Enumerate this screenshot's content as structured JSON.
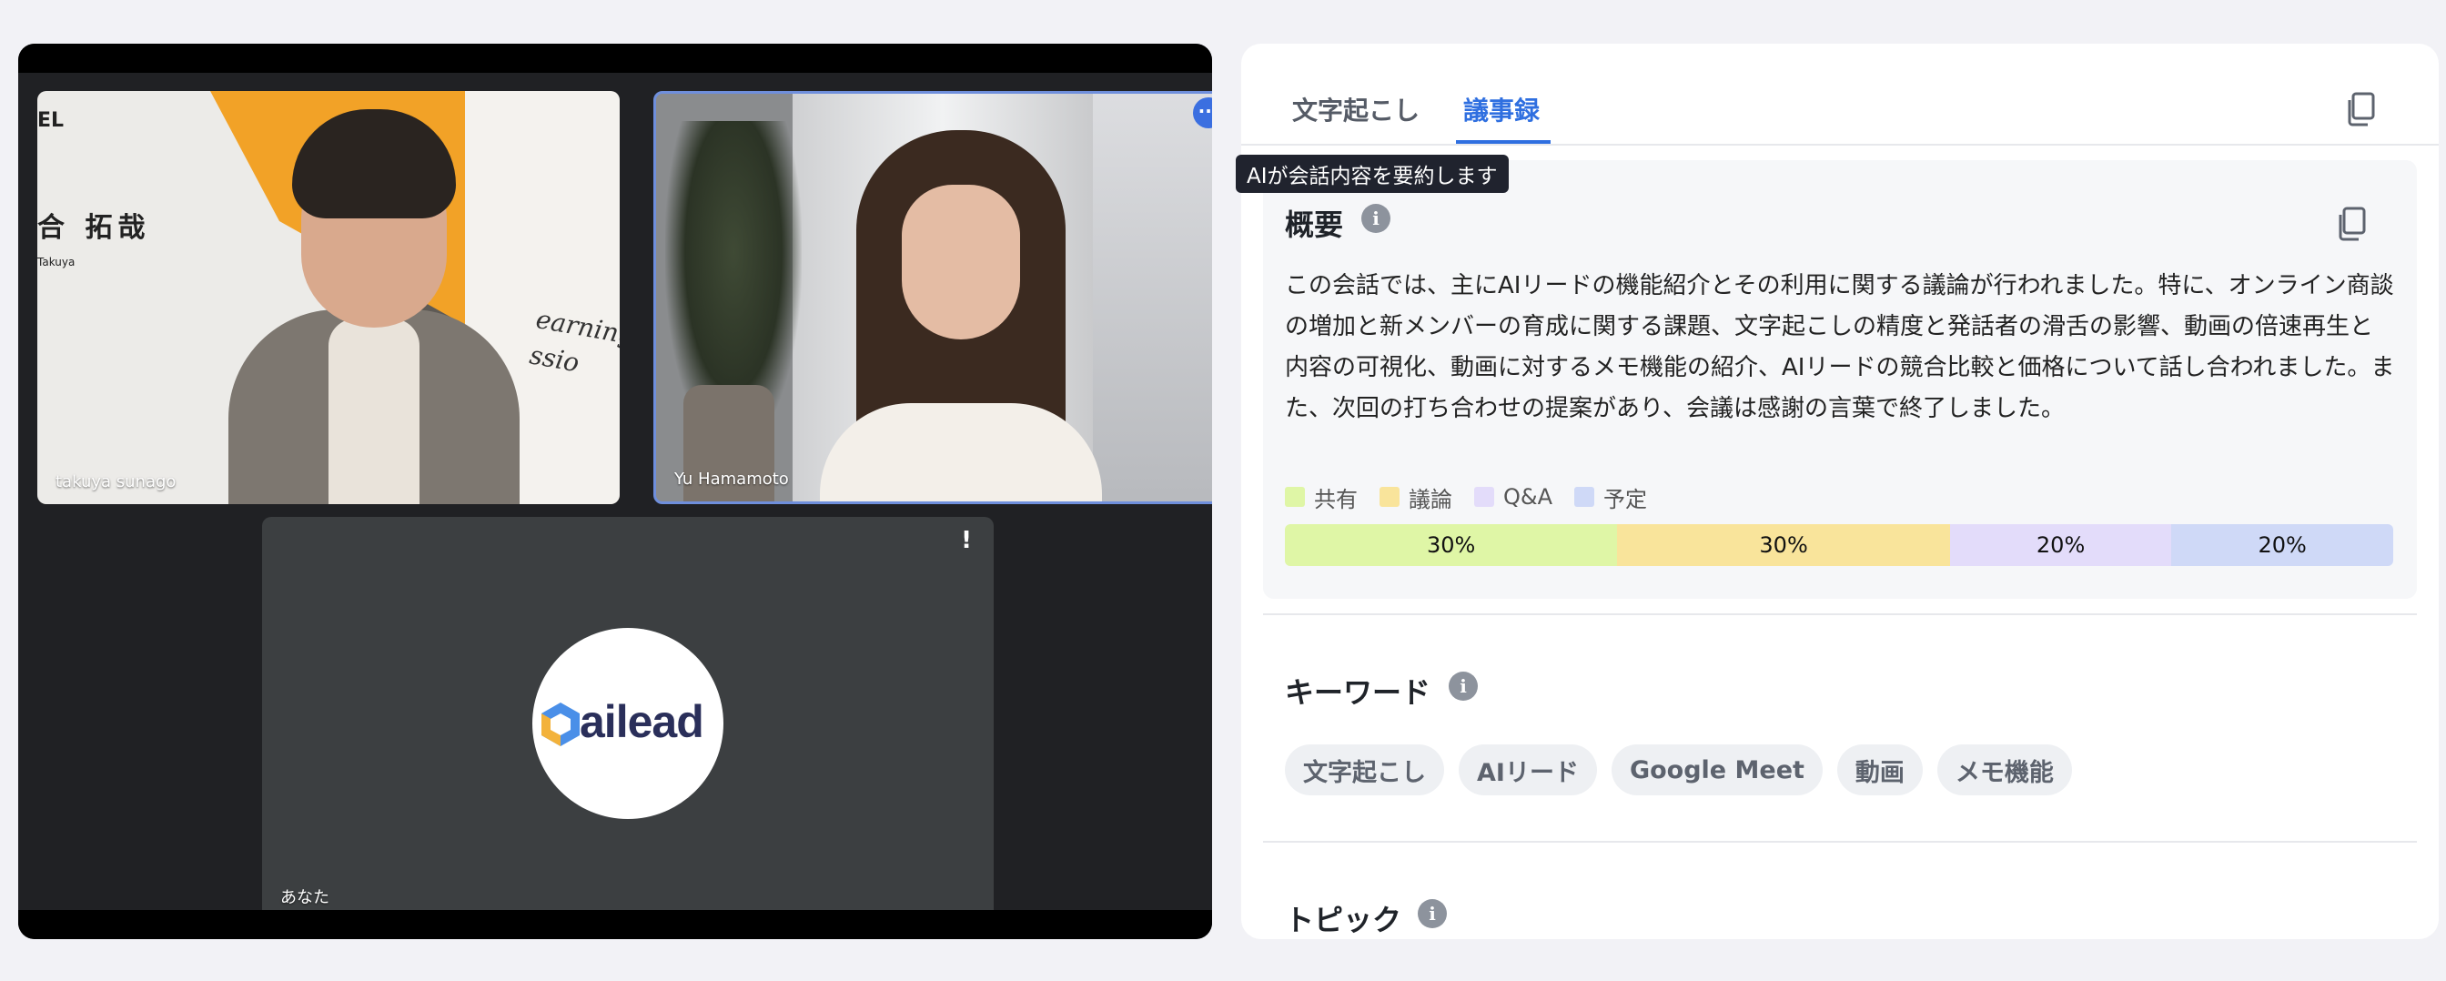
{
  "video": {
    "participants": [
      {
        "name": "takuya sunago",
        "sign_top": "EL",
        "sign_name": "合 拓哉",
        "sign_romaji": "Takuya",
        "sign_script": "earning\nssio"
      },
      {
        "name": "Yu Hamamoto"
      },
      {
        "name": "あなた",
        "logo_text": "ailead"
      }
    ]
  },
  "notes": {
    "tabs": [
      {
        "label": "文字起こし",
        "active": false
      },
      {
        "label": "議事録",
        "active": true
      }
    ],
    "tooltip": "AIが会話内容を要約します",
    "summary": {
      "title": "概要",
      "text": "この会話では、主にAIリードの機能紹介とその利用に関する議論が行われました。特に、オンライン商談の増加と新メンバーの育成に関する課題、文字起こしの精度と発話者の滑舌の影響、動画の倍速再生と内容の可視化、動画に対するメモ機能の紹介、AIリードの競合比較と価格について話し合われました。また、次回の打ち合わせの提案があり、会議は感謝の言葉で終了しました。",
      "legend": [
        {
          "label": "共有",
          "color": "#dff6a6"
        },
        {
          "label": "議論",
          "color": "#f9e49b"
        },
        {
          "label": "Q&A",
          "color": "#e3dcfa"
        },
        {
          "label": "予定",
          "color": "#cfd9f7"
        }
      ],
      "segments": [
        {
          "label": "30%",
          "value": 30,
          "color": "#dff6a6"
        },
        {
          "label": "30%",
          "value": 30,
          "color": "#f9e49b"
        },
        {
          "label": "20%",
          "value": 20,
          "color": "#e3dcfa"
        },
        {
          "label": "20%",
          "value": 20,
          "color": "#cfd9f7"
        }
      ]
    },
    "keywords": {
      "title": "キーワード",
      "items": [
        "文字起こし",
        "AIリード",
        "Google Meet",
        "動画",
        "メモ機能"
      ]
    },
    "topics": {
      "title": "トピック"
    }
  }
}
